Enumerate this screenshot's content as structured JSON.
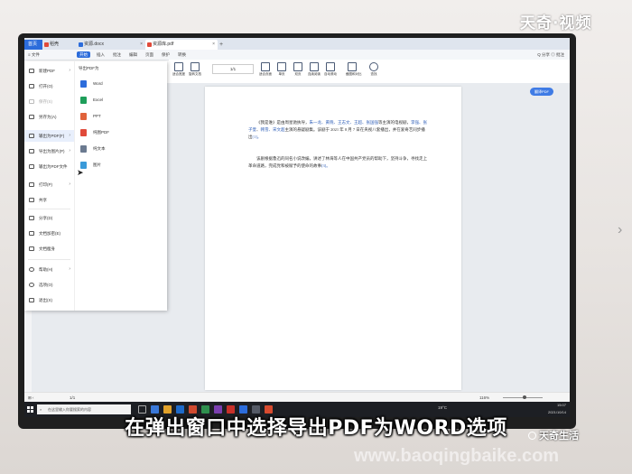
{
  "brand": {
    "top": "天奇·视频",
    "bottom": "天奇生活",
    "watermark": "www.baoqingbaike.com"
  },
  "subtitle": "在弹出窗口中选择导出PDF为WORD选项",
  "tabs": [
    {
      "label": "首页",
      "color": "#ffffff"
    },
    {
      "label": "稻壳",
      "color": "#e04a3a"
    },
    {
      "label": "资源.docx",
      "color": "#2c6cdb"
    },
    {
      "label": "资源库.pdf",
      "color": "#e04a3a"
    }
  ],
  "new_tab": "+",
  "menubar": {
    "file": "文件",
    "items": [
      "开始",
      "插入",
      "批注",
      "编辑",
      "页面",
      "保护",
      "转换"
    ],
    "right": "Q 分享 ◎ 批注"
  },
  "toolbar": {
    "buttons": [
      {
        "label": "适合宽度"
      },
      {
        "label": "旋转文档"
      },
      {
        "label": "适合页面"
      },
      {
        "label": "单页"
      },
      {
        "label": "双页"
      },
      {
        "label": "连续阅读"
      },
      {
        "label": "自动滚动"
      },
      {
        "label": "截图和对比"
      },
      {
        "label": "查找"
      }
    ],
    "page_box": "1/1",
    "mini": [
      "背景",
      "拆分",
      "截图",
      "阅读模式"
    ]
  },
  "file_menu": {
    "items": [
      {
        "label": "新建PDF",
        "arrow": true
      },
      {
        "label": "打开(O)",
        "arrow": false
      },
      {
        "label": "保存(S)",
        "arrow": false
      },
      {
        "label": "另存为(A)",
        "arrow": false
      },
      {
        "label": "输出为PDF(F)",
        "arrow": true,
        "selected": true
      },
      {
        "label": "导出为图片(P)",
        "arrow": true
      },
      {
        "label": "输出为PDF文件",
        "arrow": false
      },
      {
        "label": "打印(P)",
        "arrow": true
      },
      {
        "label": "共享",
        "arrow": false
      },
      {
        "label": "分享(D)",
        "arrow": false
      },
      {
        "label": "文档加密(E)",
        "arrow": false
      },
      {
        "label": "文档瘦身",
        "arrow": false
      },
      {
        "label": "帮助(H)",
        "arrow": true
      },
      {
        "label": "选项(O)",
        "arrow": false
      },
      {
        "label": "退出(X)",
        "arrow": false
      }
    ],
    "submenu_title": "导出PDF为",
    "submenu": [
      {
        "label": "Word",
        "color": "#2c6cdb"
      },
      {
        "label": "Excel",
        "color": "#1e9e5a"
      },
      {
        "label": "PPT",
        "color": "#e0623a"
      },
      {
        "label": "纯图PDF",
        "color": "#e04a3a"
      },
      {
        "label": "纯文本",
        "color": "#6b7a90"
      },
      {
        "label": "图片",
        "color": "#3a9ad9"
      }
    ]
  },
  "ai_button": "翻译PDF",
  "document": {
    "para1_a": "《我是谁》是由周星驰执导，",
    "para1_hl1": "朱一龙、黄晓、王志文、王超、张国强",
    "para1_b": "等主演的电视剧，",
    "para1_hl2": "李强、张子萱",
    "para1_c": "、",
    "para1_hl3": "韩雪、宋文超",
    "para1_d": "主演的悬疑剧集。该剧于 2021 年 8 月 7 日在央视八套播出，并在爱奇艺同步播出",
    "para1_e": "[1]。",
    "para2": "该剧根据鲁迅的同名小说改编，讲述了林海等人在中国共产党员的帮助下，坚持斗争，寻找走上革命道路，完成党和被赋予的使命的故事",
    "para2_e": "[3]。"
  },
  "statusbar": {
    "page": "1/1",
    "zoom": "116%"
  },
  "taskbar": {
    "search_placeholder": "在这里输入你要搜索的内容",
    "weather": "19°C",
    "time": "15:07",
    "date": "2021/10/14",
    "icon_colors": [
      "#3a78d8",
      "#1e6ac9",
      "#d04a2f",
      "#e2a22a",
      "#2f8f4e",
      "#7b3fb0",
      "#c9312a",
      "#2c6cdb",
      "#555a66",
      "#d84b2f"
    ]
  }
}
